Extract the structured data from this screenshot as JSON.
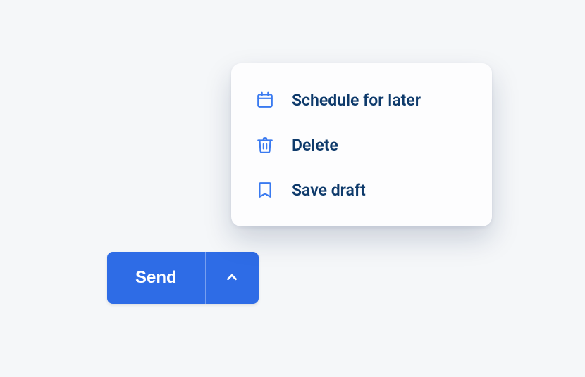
{
  "colors": {
    "primary": "#2e6ce6",
    "menu_text": "#0e3a6b",
    "icon_stroke": "#3a7af0",
    "background": "#f5f7f9"
  },
  "button": {
    "label": "Send"
  },
  "menu": {
    "items": [
      {
        "label": "Schedule for later",
        "icon": "calendar-icon"
      },
      {
        "label": "Delete",
        "icon": "trash-icon"
      },
      {
        "label": "Save draft",
        "icon": "bookmark-icon"
      }
    ]
  }
}
